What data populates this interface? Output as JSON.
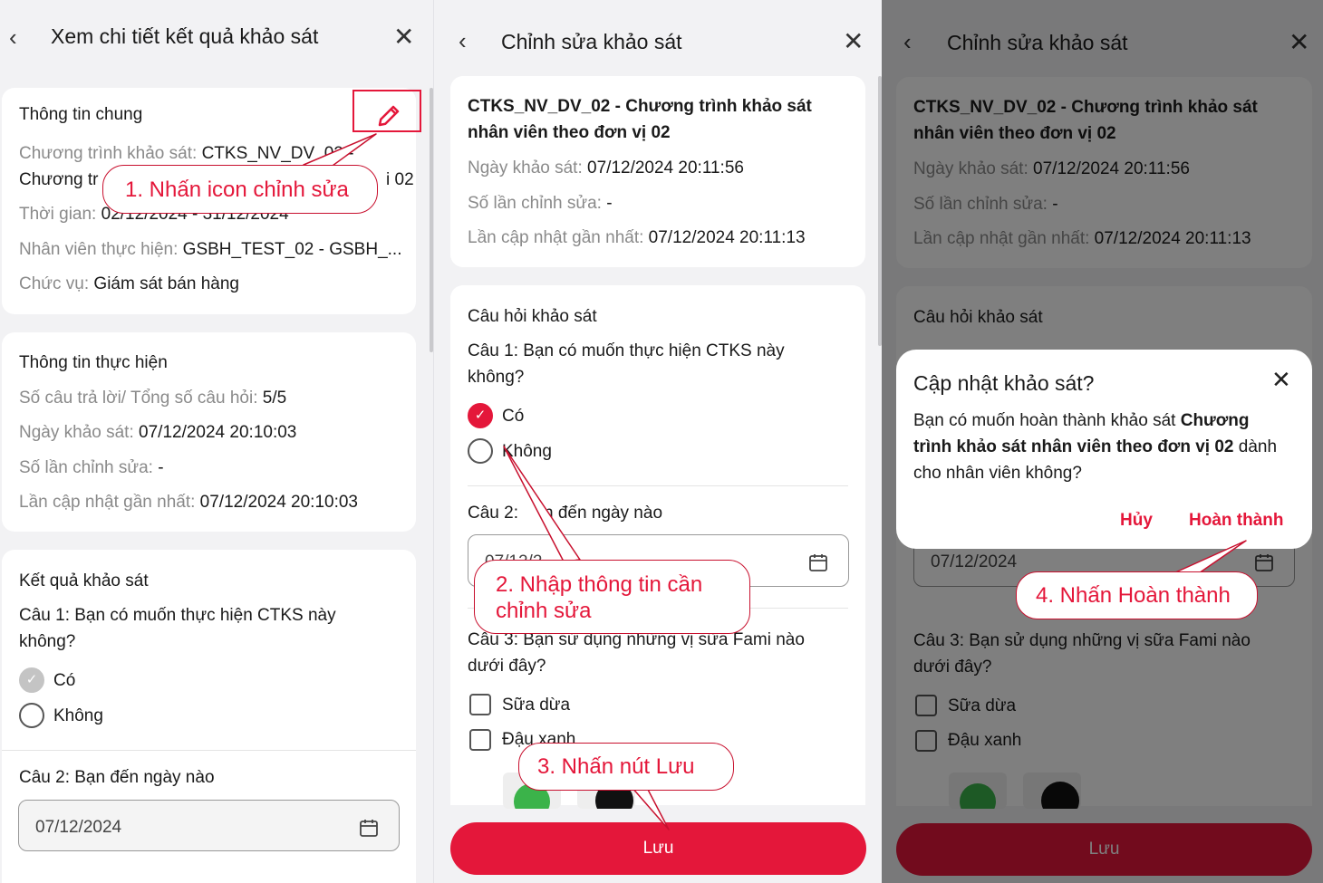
{
  "panel1": {
    "header": {
      "back": "‹",
      "title": "Xem chi tiết kết quả khảo sát",
      "close": "✕"
    },
    "general": {
      "title": "Thông tin chung",
      "program_label": "Chương trình khảo sát:",
      "program_value": "CTKS_NV_DV_02 -",
      "program_cont_visible_start": "Chương tr",
      "program_cont_visible_end": "i 02",
      "time_label": "Thời gian:",
      "time_value": "02/12/2024 - 31/12/2024",
      "staff_label": "Nhân viên thực hiện:",
      "staff_value": "GSBH_TEST_02 - GSBH_...",
      "position_label": "Chức vụ:",
      "position_value": "Giám sát bán hàng"
    },
    "exec": {
      "title": "Thông tin thực hiện",
      "answers_label": "Số câu trả lời/ Tổng số câu hỏi:",
      "answers_value": "5/5",
      "date_label": "Ngày khảo sát:",
      "date_value": "07/12/2024 20:10:03",
      "edits_label": "Số lần chỉnh sửa:",
      "edits_value": "-",
      "updated_label": "Lần cập nhật gần nhất:",
      "updated_value": "07/12/2024 20:10:03"
    },
    "results": {
      "title": "Kết quả khảo sát",
      "q1_num": "Câu 1",
      "q1_text": ": Bạn có muốn thực hiện CTKS này",
      "q1_text2": "không?",
      "opt_yes": "Có",
      "opt_no": "Không",
      "q2_num": "Câu 2",
      "q2_text": ": Bạn đến ngày nào",
      "q2_value": "07/12/2024"
    }
  },
  "panel2": {
    "header": {
      "back": "‹",
      "title": "Chỉnh sửa khảo sát",
      "close": "✕"
    },
    "info": {
      "title1": "CTKS_NV_DV_02 - Chương trình khảo sát",
      "title2": "nhân viên theo đơn vị 02",
      "date_label": "Ngày khảo sát:",
      "date_value": "07/12/2024 20:11:56",
      "edits_label": "Số lần chỉnh sửa:",
      "edits_value": "-",
      "updated_label": "Lần cập nhật gần nhất:",
      "updated_value": "07/12/2024 20:11:13"
    },
    "questions": {
      "title": "Câu hỏi khảo sát",
      "q1_num": "Câu 1",
      "q1_text": ": Bạn có muốn thực hiện CTKS này",
      "q1_text2": "không?",
      "opt_yes": "Có",
      "opt_no": "Không",
      "q2_num": "Câu 2",
      "q2_text_visible": ": ",
      "q2_text_end": "n đến ngày nào",
      "q2_value_visible": "07/12/2",
      "q3_num": "Câu 3",
      "q3_text": ": Bạn sử dụng những vị sữa Fami nào",
      "q3_text2": "dưới đây?",
      "opt_coconut": "Sữa dừa",
      "opt_mungbean": "Đậu xanh"
    },
    "save_label": "Lưu"
  },
  "panel3": {
    "header": {
      "back": "‹",
      "title": "Chỉnh sửa khảo sát",
      "close": "✕"
    },
    "info": {
      "title1": "CTKS_NV_DV_02 - Chương trình khảo sát",
      "title2": "nhân viên theo đơn vị 02",
      "date_label": "Ngày khảo sát:",
      "date_value": "07/12/2024 20:11:56",
      "edits_label": "Số lần chỉnh sửa:",
      "edits_value": "-",
      "updated_label": "Lần cập nhật gần nhất:",
      "updated_value": "07/12/2024 20:11:13"
    },
    "questions": {
      "title": "Câu hỏi khảo sát",
      "q2_value": "07/12/2024",
      "q3_num": "Câu 3",
      "q3_text": ": Bạn sử dụng những vị sữa Fami nào",
      "q3_text2": "dưới đây?",
      "opt_coconut": "Sữa dừa",
      "opt_mungbean": "Đậu xanh"
    },
    "save_label": "Lưu",
    "dialog": {
      "title": "Cập nhật khảo sát?",
      "close": "✕",
      "body1_a": "Bạn có muốn hoàn thành khảo sát ",
      "body1_b": "Chương",
      "body2_a": "trình khảo sát nhân viên theo đơn vị 02",
      "body2_b": " dành",
      "body3": "cho nhân viên không?",
      "cancel": "Hủy",
      "confirm": "Hoàn thành"
    }
  },
  "callouts": {
    "c1": "1. Nhấn icon chỉnh sửa",
    "c2_line1": "2. Nhập thông tin cần",
    "c2_line2": "chỉnh sửa",
    "c3": "3. Nhấn nút Lưu",
    "c4": "4. Nhấn Hoàn thành"
  },
  "colors": {
    "accent": "#e4173a",
    "label_grey": "#8a8a8a",
    "background": "#f2f2f4"
  },
  "icons": [
    "back-chevron-icon",
    "close-icon",
    "edit-pencil-icon",
    "calendar-icon",
    "check-icon"
  ]
}
